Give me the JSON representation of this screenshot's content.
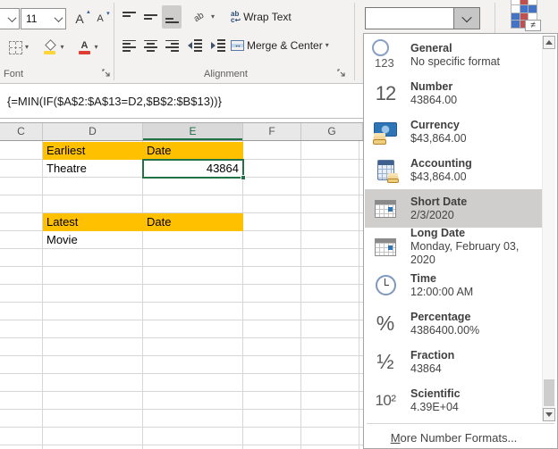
{
  "ribbon": {
    "font_group": {
      "label": "Font",
      "font_size_value": "11"
    },
    "alignment_group": {
      "label": "Alignment",
      "wrap_text_label": "Wrap Text",
      "merge_center_label": "Merge & Center"
    },
    "number_format_value": ""
  },
  "formula_bar": {
    "formula": "{=MIN(IF($A$2:$A$13=D2,$B$2:$B$13))}"
  },
  "grid": {
    "column_headers": [
      "C",
      "D",
      "E",
      "F",
      "G"
    ],
    "selected_column": "E",
    "cells": [
      {
        "ref": "D1",
        "text": "Earliest",
        "fill": "#FFC000"
      },
      {
        "ref": "E1",
        "text": "Date",
        "fill": "#FFC000"
      },
      {
        "ref": "D2",
        "text": "Theatre"
      },
      {
        "ref": "E2",
        "text": "43864",
        "selected": true,
        "align": "right"
      },
      {
        "ref": "D5",
        "text": "Latest",
        "fill": "#FFC000"
      },
      {
        "ref": "E5",
        "text": "Date",
        "fill": "#FFC000"
      },
      {
        "ref": "D6",
        "text": "Movie"
      }
    ]
  },
  "format_dropdown": {
    "items": [
      {
        "label": "General",
        "example": "No specific format",
        "icon": "general-icon"
      },
      {
        "label": "Number",
        "example": "43864.00",
        "icon": "number-icon"
      },
      {
        "label": "Currency",
        "example": "$43,864.00",
        "icon": "currency-icon"
      },
      {
        "label": "Accounting",
        "example": "$43,864.00",
        "icon": "accounting-icon"
      },
      {
        "label": "Short Date",
        "example": "2/3/2020",
        "icon": "short-date-icon",
        "selected": true
      },
      {
        "label": "Long Date",
        "example": "Monday, February 03, 2020",
        "icon": "long-date-icon"
      },
      {
        "label": "Time",
        "example": "12:00:00 AM",
        "icon": "time-icon"
      },
      {
        "label": "Percentage",
        "example": "4386400.00%",
        "icon": "percentage-icon"
      },
      {
        "label": "Fraction",
        "example": "43864",
        "icon": "fraction-icon"
      },
      {
        "label": "Scientific",
        "example": "4.39E+04",
        "icon": "scientific-icon"
      }
    ],
    "more_label_prefix": "M",
    "more_label_rest": "ore Number Formats..."
  },
  "colors": {
    "highlight_yellow": "#FFC000",
    "selection_green": "#217346",
    "selected_item_gray": "#CFCECD"
  }
}
